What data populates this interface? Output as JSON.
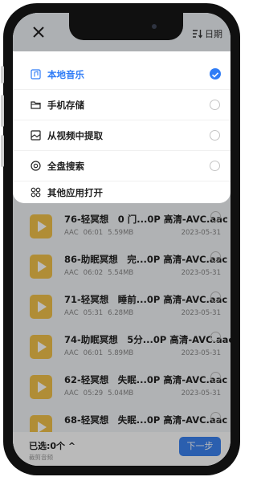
{
  "header": {
    "close_icon": "close-icon",
    "sort_icon": "sort-icon",
    "sort_label": "日期"
  },
  "source_menu": {
    "items": [
      {
        "label": "本地音乐",
        "icon": "music-file-icon",
        "selected": true
      },
      {
        "label": "手机存储",
        "icon": "folder-icon",
        "selected": false
      },
      {
        "label": "从视频中提取",
        "icon": "video-extract-icon",
        "selected": false
      },
      {
        "label": "全盘搜索",
        "icon": "disk-search-icon",
        "selected": false
      },
      {
        "label": "其他应用打开",
        "icon": "apps-grid-icon",
        "selected": false
      }
    ]
  },
  "files": [
    {
      "title": "76-轻冥想　0 门...0P 高清-AVC.aac",
      "format": "AAC",
      "duration": "06:01",
      "size": "5.59MB",
      "date": "2023-05-31"
    },
    {
      "title": "86-助眠冥想　完...0P 高清-AVC.aac",
      "format": "AAC",
      "duration": "06:02",
      "size": "5.54MB",
      "date": "2023-05-31"
    },
    {
      "title": "71-轻冥想　睡前...0P 高清-AVC.aac",
      "format": "AAC",
      "duration": "05:31",
      "size": "6.28MB",
      "date": "2023-05-31"
    },
    {
      "title": "74-助眠冥想　5分...0P 高清-AVC.aac",
      "format": "AAC",
      "duration": "06:01",
      "size": "5.89MB",
      "date": "2023-05-31"
    },
    {
      "title": "62-轻冥想　失眠...0P 高清-AVC.aac",
      "format": "AAC",
      "duration": "05:29",
      "size": "5.04MB",
      "date": "2023-05-31"
    },
    {
      "title": "68-轻冥想　失眠...0P 高清-AVC.aac",
      "format": "AAC",
      "duration": "",
      "size": "",
      "date": ""
    }
  ],
  "footer": {
    "selected_label": "已选:0个",
    "sub_label": "裁剪音频",
    "next_label": "下一步"
  },
  "colors": {
    "accent": "#2f7cf6",
    "thumb": "#f2c24a"
  }
}
